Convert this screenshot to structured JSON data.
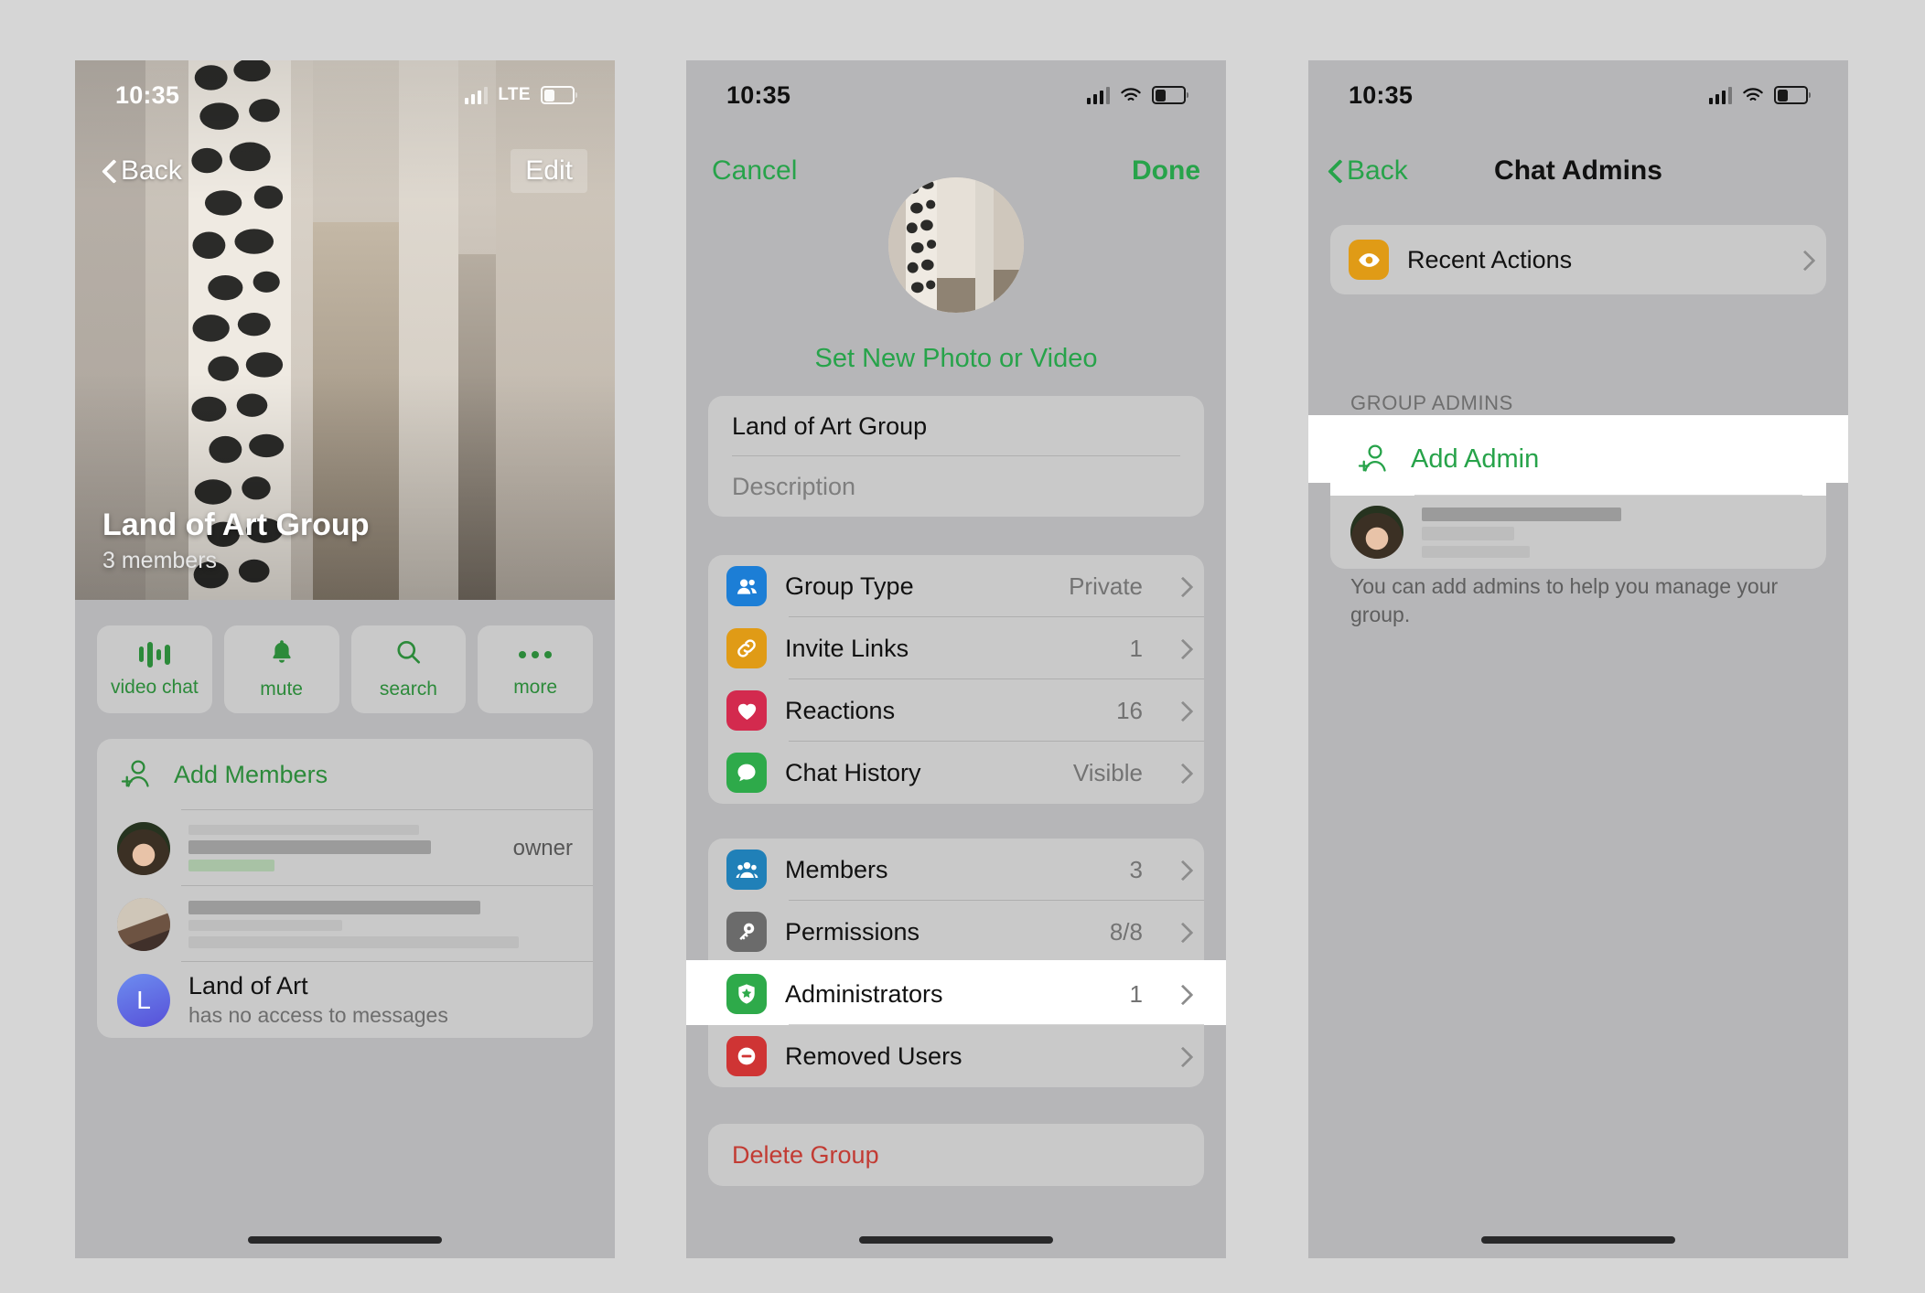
{
  "theme": {
    "green": "#27a34a",
    "green_dim": "#2c8a3a",
    "red": "#c23b33",
    "card": "#c9c9c9",
    "page_bg": "#b6b6b8",
    "canvas_bg": "#d6d6d6",
    "highlight": "#ffffff"
  },
  "status_bar": {
    "time": "10:35",
    "carrier_label": "LTE",
    "signal_icon": "cellular-bars-icon",
    "wifi_icon": "wifi-icon",
    "battery_icon": "battery-icon"
  },
  "screen1": {
    "nav": {
      "back_label": "Back",
      "back_icon": "chevron-left-icon",
      "edit_label": "Edit"
    },
    "hero": {
      "title": "Land of Art Group",
      "subtitle": "3 members"
    },
    "actions": [
      {
        "label": "video chat",
        "icon": "video-chat-waveform-icon"
      },
      {
        "label": "mute",
        "icon": "bell-icon"
      },
      {
        "label": "search",
        "icon": "search-icon"
      },
      {
        "label": "more",
        "icon": "more-dots-icon"
      }
    ],
    "add_members": {
      "label": "Add Members",
      "icon": "add-user-icon"
    },
    "members": [
      {
        "name_redacted": true,
        "status_redacted": true,
        "role": "owner",
        "avatar": "photo-avatar-1"
      },
      {
        "name_redacted": true,
        "status_redacted": true,
        "role": "",
        "avatar": "photo-avatar-2"
      },
      {
        "name": "Land of Art",
        "status": "has no access to messages",
        "avatar_letter": "L",
        "avatar": "letter-avatar"
      }
    ]
  },
  "screen2": {
    "nav": {
      "cancel_label": "Cancel",
      "done_label": "Done"
    },
    "avatar": {
      "icon": "group-photo-avatar"
    },
    "set_photo_label": "Set New Photo or Video",
    "name_field": {
      "value": "Land of Art Group"
    },
    "description_field": {
      "placeholder": "Description",
      "value": ""
    },
    "group_settings": [
      {
        "label": "Group Type",
        "value": "Private",
        "icon": "people-icon",
        "icon_color": "#1c7ed6",
        "chevron": "chevron-right-icon"
      },
      {
        "label": "Invite Links",
        "value": "1",
        "icon": "link-icon",
        "icon_color": "#e09b16",
        "chevron": "chevron-right-icon"
      },
      {
        "label": "Reactions",
        "value": "16",
        "icon": "heart-icon",
        "icon_color": "#d32a4e",
        "chevron": "chevron-right-icon"
      },
      {
        "label": "Chat History",
        "value": "Visible",
        "icon": "bubble-icon",
        "icon_color": "#2eaa4a",
        "chevron": "chevron-right-icon"
      }
    ],
    "admin_settings": [
      {
        "label": "Members",
        "value": "3",
        "icon": "group-people-icon",
        "icon_color": "#2080b8",
        "chevron": "chevron-right-icon",
        "highlighted": false
      },
      {
        "label": "Permissions",
        "value": "8/8",
        "icon": "key-icon",
        "icon_color": "#6b6b6b",
        "chevron": "chevron-right-icon",
        "highlighted": false
      },
      {
        "label": "Administrators",
        "value": "1",
        "icon": "shield-star-icon",
        "icon_color": "#2eaa4a",
        "chevron": "chevron-right-icon",
        "highlighted": true
      },
      {
        "label": "Removed Users",
        "value": "",
        "icon": "minus-circle-icon",
        "icon_color": "#cf3434",
        "chevron": "chevron-right-icon",
        "highlighted": false
      }
    ],
    "delete_group_label": "Delete Group"
  },
  "screen3": {
    "nav": {
      "back_label": "Back",
      "back_icon": "chevron-left-icon",
      "title": "Chat Admins"
    },
    "recent_actions": {
      "label": "Recent Actions",
      "icon": "eye-icon",
      "icon_color": "#e09b16",
      "chevron": "chevron-right-icon"
    },
    "section_header": "GROUP ADMINS",
    "add_admin": {
      "label": "Add Admin",
      "icon": "add-user-icon",
      "highlighted": true
    },
    "admin_entry": {
      "name_redacted": true,
      "avatar": "photo-avatar-1"
    },
    "footnote": "You can add admins to help you manage your group."
  }
}
